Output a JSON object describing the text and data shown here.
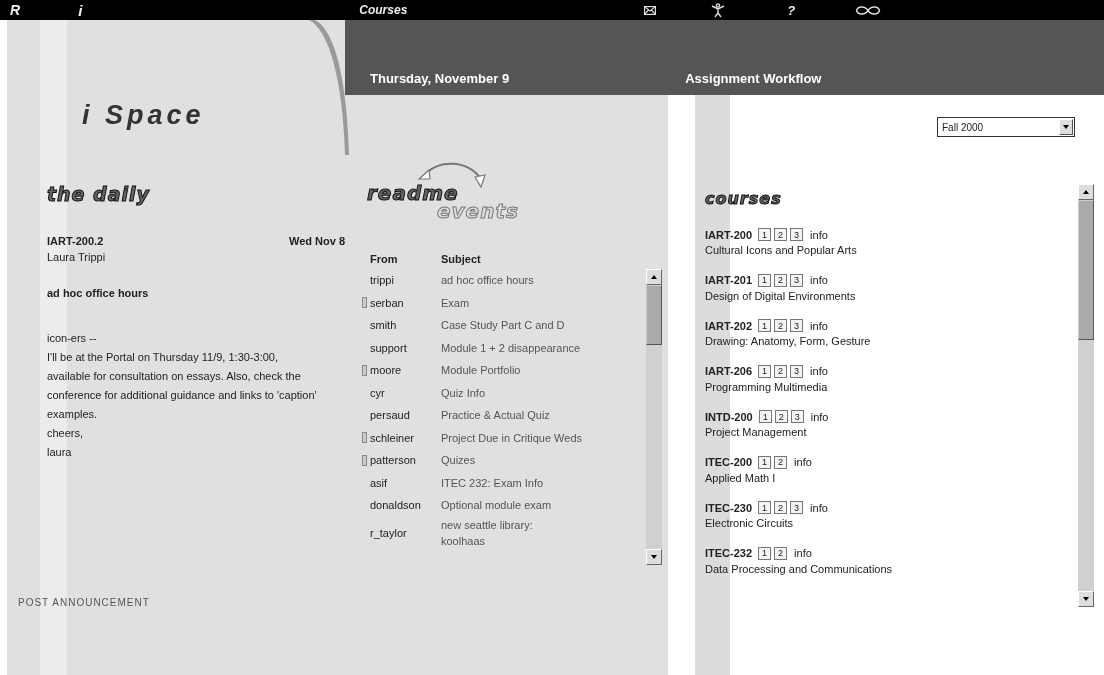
{
  "top_bar": {
    "r_label": "R",
    "i_label": "i",
    "title": "Courses",
    "help_label": "?"
  },
  "brand": {
    "title": "i Space"
  },
  "header": {
    "date": "Thursday, November 9",
    "workflow_title": "Assignment Workflow"
  },
  "daily": {
    "heading": "the daily",
    "course": "IART-200.2",
    "date": "Wed Nov 8",
    "author": "Laura Trippi",
    "subject": "ad hoc office hours",
    "body": [
      "icon-ers --",
      "I'll be at the Portal on Thursday 11/9, 1:30-3:00, available for consultation on essays. Also, check the conference for additional guidance and links to 'caption' examples.",
      "cheers,",
      "laura"
    ],
    "post_link": "POST ANNOUNCEMENT"
  },
  "messages": {
    "logo_top": "readme",
    "logo_bottom": "events",
    "columns": [
      "From",
      "Subject"
    ],
    "rows": [
      {
        "from": "trippi",
        "subject": "ad hoc office hours",
        "flagged": false
      },
      {
        "from": "serban",
        "subject": "Exam",
        "flagged": true
      },
      {
        "from": "smith",
        "subject": "Case Study Part C and D",
        "flagged": false
      },
      {
        "from": "support",
        "subject": "Module 1 + 2 disappearance",
        "flagged": false
      },
      {
        "from": "moore",
        "subject": "Module Portfolio",
        "flagged": true
      },
      {
        "from": "cyr",
        "subject": "Quiz Info",
        "flagged": false
      },
      {
        "from": "persaud",
        "subject": "Practice & Actual Quiz",
        "flagged": false
      },
      {
        "from": "schleiner",
        "subject": "Project Due in Critique Weds",
        "flagged": true
      },
      {
        "from": "patterson",
        "subject": "Quizes",
        "flagged": true
      },
      {
        "from": "asif",
        "subject": "ITEC 232: Exam Info",
        "flagged": false
      },
      {
        "from": "donaldson",
        "subject": "Optional module exam",
        "flagged": false
      },
      {
        "from": "r_taylor",
        "subject": "new seattle library: koolhaas",
        "flagged": false
      }
    ]
  },
  "courses": {
    "term": "Fall 2000",
    "heading": "courses",
    "items": [
      {
        "code": "IART-200",
        "sections": [
          "1",
          "2",
          "3"
        ],
        "info": "info",
        "title": "Cultural Icons and Popular Arts"
      },
      {
        "code": "IART-201",
        "sections": [
          "1",
          "2",
          "3"
        ],
        "info": "info",
        "title": "Design of Digital Environments"
      },
      {
        "code": "IART-202",
        "sections": [
          "1",
          "2",
          "3"
        ],
        "info": "info",
        "title": "Drawing: Anatomy, Form, Gesture"
      },
      {
        "code": "IART-206",
        "sections": [
          "1",
          "2",
          "3"
        ],
        "info": "info",
        "title": "Programming Multimedia"
      },
      {
        "code": "INTD-200",
        "sections": [
          "1",
          "2",
          "3"
        ],
        "info": "info",
        "title": "Project Management"
      },
      {
        "code": "ITEC-200",
        "sections": [
          "1",
          "2"
        ],
        "info": "info",
        "title": "Applied Math I"
      },
      {
        "code": "ITEC-230",
        "sections": [
          "1",
          "2",
          "3"
        ],
        "info": "info",
        "title": "Electronic Circuits"
      },
      {
        "code": "ITEC-232",
        "sections": [
          "1",
          "2"
        ],
        "info": "info",
        "title": "Data Processing and Communications"
      }
    ]
  }
}
